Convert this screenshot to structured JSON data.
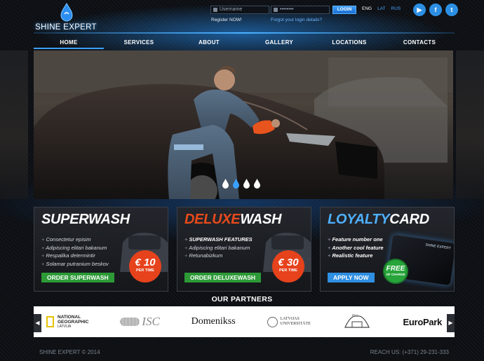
{
  "logo": {
    "name": "SHINE EXPERT"
  },
  "login": {
    "username_placeholder": "Username",
    "password_placeholder": "••••••••",
    "login_label": "LOGIN",
    "register_label": "Register NOW!",
    "forgot_label": "Forgot your login details?"
  },
  "languages": [
    "ENG",
    "LAT",
    "RUS"
  ],
  "active_language": "ENG",
  "social": [
    {
      "icon": "youtube-icon",
      "glyph": "▶"
    },
    {
      "icon": "facebook-icon",
      "glyph": "f"
    },
    {
      "icon": "twitter-icon",
      "glyph": "t"
    }
  ],
  "nav": [
    {
      "label": "HOME",
      "active": true
    },
    {
      "label": "SERVICES"
    },
    {
      "label": "ABOUT"
    },
    {
      "label": "GALLERY"
    },
    {
      "label": "LOCATIONS"
    },
    {
      "label": "CONTACTS"
    }
  ],
  "slider": {
    "count": 4,
    "active_index": 1
  },
  "cards": {
    "superwash": {
      "title_a": "SUPERWASH",
      "items": [
        "Consectetur episim",
        "Adipiscing elitari bakanum",
        "Respalika determintir",
        "Solamar putranium beskov"
      ],
      "price": "€ 10",
      "price_unit": "PER TIME",
      "button": "ORDER SUPERWASH"
    },
    "deluxewash": {
      "title_a": "DELUXE",
      "title_b": "WASH",
      "items": [
        "SUPERWASH FEATURES",
        "Adipiscing elitari bakanum",
        "Retunabizkum"
      ],
      "price": "€ 30",
      "price_unit": "PER TIME",
      "button": "ORDER DELUXEWASH"
    },
    "loyalty": {
      "title_a": "LOYALTY",
      "title_b": "CARD",
      "items": [
        "Feature number one",
        "Another cool feature",
        "Realistic feature"
      ],
      "badge": "FREE",
      "badge_sub": "OF CHARGE",
      "card_brand": "SHINE EXPERT",
      "button": "APPLY NOW"
    }
  },
  "partners": {
    "heading": "OUR PARTNERS",
    "logos": {
      "ng_line1": "NATIONAL",
      "ng_line2": "GEOGRAPHIC",
      "ng_line3": "LATVIJA",
      "isc": "ISC",
      "domenikss": "Domenikss",
      "lu_line1": "LATVIJAS",
      "lu_line2": "UNIVERSITĀTE",
      "rtu": "RTU",
      "europark": "EuroPark"
    }
  },
  "footer": {
    "copyright": "SHINE EXPERT © 2014",
    "reach": "REACH US: (+371) 29-231-333"
  },
  "colors": {
    "accent_blue": "#3aa0ff",
    "accent_red": "#e84a1c",
    "accent_green": "#2d9a37"
  }
}
